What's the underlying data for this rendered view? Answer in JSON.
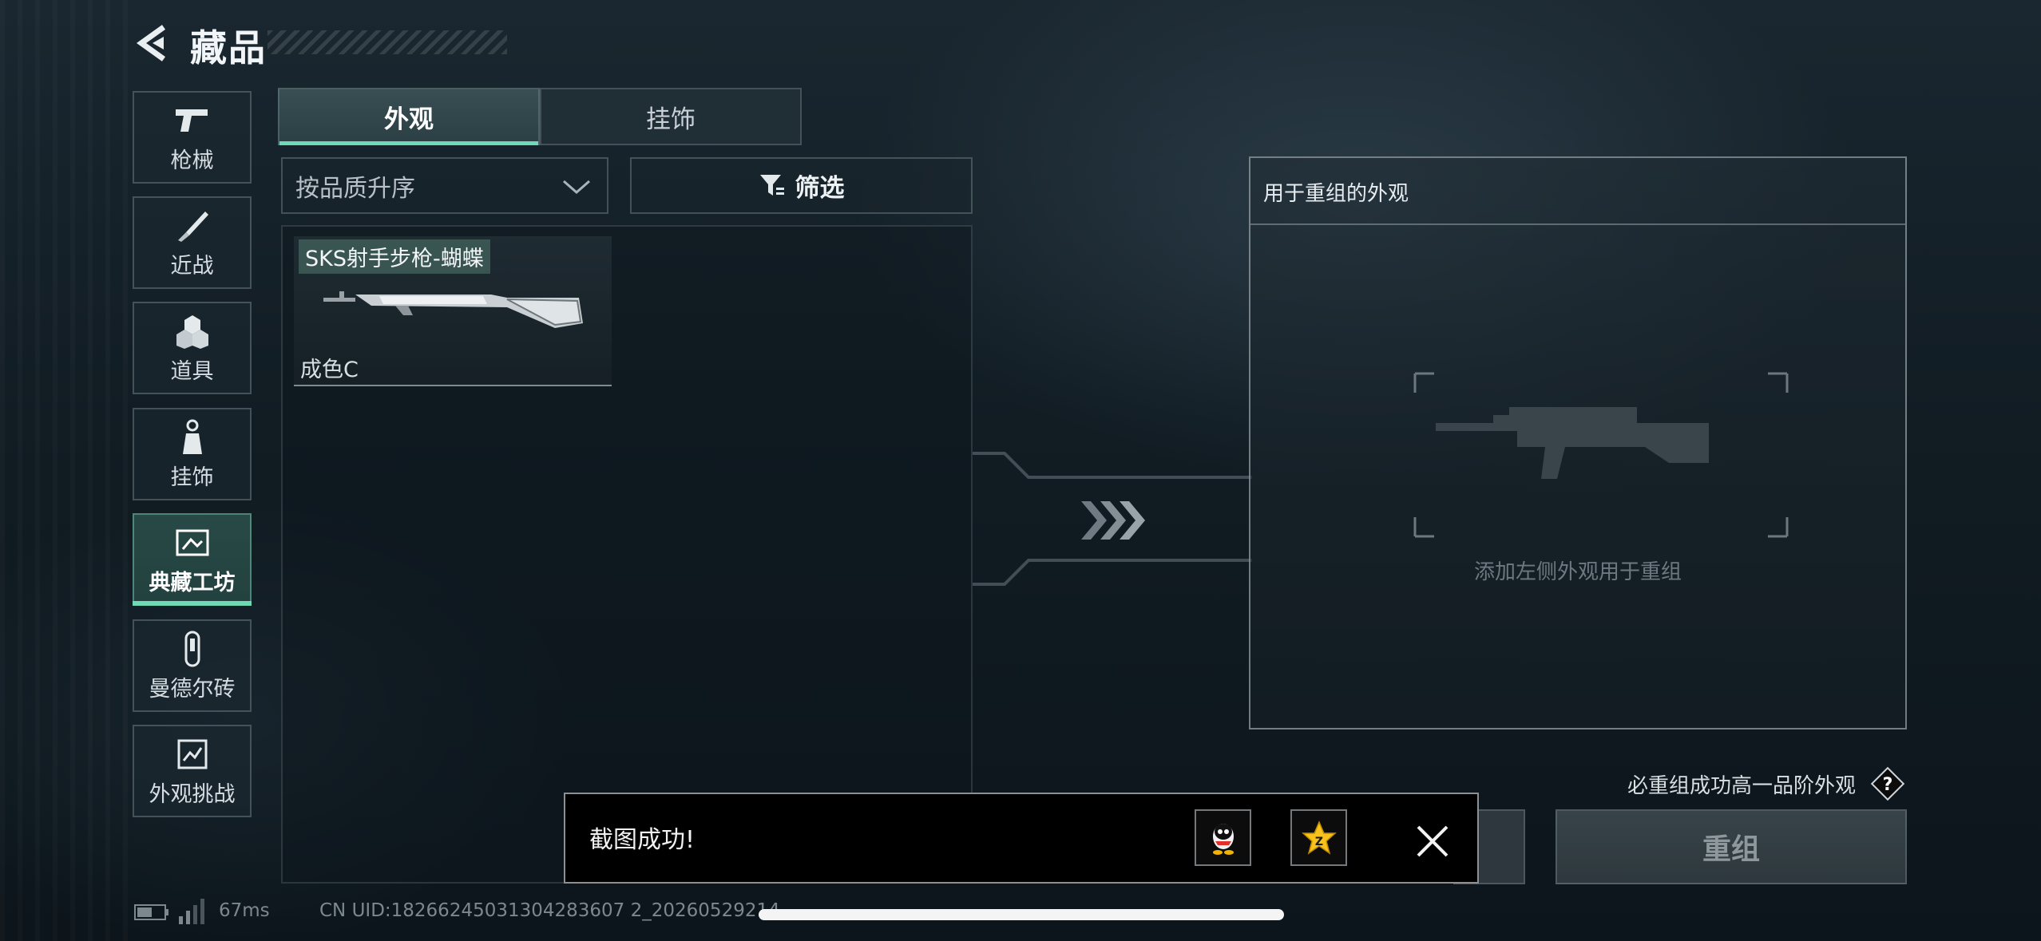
{
  "header": {
    "title": "藏品",
    "back_icon": "back-arrow-icon"
  },
  "sidebar": {
    "items": [
      {
        "label": "枪械",
        "icon": "pistol-icon",
        "active": false
      },
      {
        "label": "近战",
        "icon": "knife-icon",
        "active": false
      },
      {
        "label": "道具",
        "icon": "grenade-icon",
        "active": false
      },
      {
        "label": "挂饰",
        "icon": "charm-icon",
        "active": false
      },
      {
        "label": "典藏工坊",
        "icon": "workshop-icon",
        "active": true
      },
      {
        "label": "曼德尔砖",
        "icon": "brick-icon",
        "active": false
      },
      {
        "label": "外观挑战",
        "icon": "challenge-icon",
        "active": false
      }
    ]
  },
  "tabs": [
    {
      "label": "外观",
      "active": true
    },
    {
      "label": "挂饰",
      "active": false
    }
  ],
  "sort": {
    "value": "按品质升序"
  },
  "filter": {
    "label": "筛选"
  },
  "items": [
    {
      "name": "SKS射手步枪-蝴蝶",
      "grade": "成色C"
    }
  ],
  "remix_panel": {
    "title": "用于重组的外观",
    "hint": "添加左侧外观用于重组"
  },
  "note": "必重组成功高一品阶外观",
  "remix_button": {
    "label": "重组"
  },
  "toast": {
    "message": "截图成功!"
  },
  "status": {
    "ping": "67ms",
    "uid": "CN UID:18266245031304283607 2_20260529214"
  },
  "colors": {
    "accent": "#6fd9b6",
    "background": "#111c23"
  }
}
